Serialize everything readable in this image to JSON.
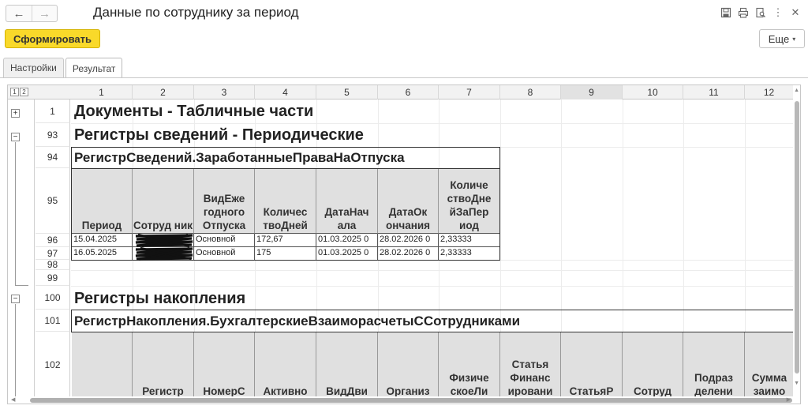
{
  "window": {
    "title": "Данные по сотруднику за период",
    "nav_back": "←",
    "nav_forward": "→"
  },
  "toolbar": {
    "form_button": "Сформировать",
    "more_button": "Еще",
    "more_caret": "▾"
  },
  "tabs": [
    {
      "label": "Настройки",
      "active": false
    },
    {
      "label": "Результат",
      "active": true
    }
  ],
  "sheet": {
    "level_buttons": [
      "1",
      "2"
    ],
    "columns": [
      "1",
      "2",
      "3",
      "4",
      "5",
      "6",
      "7",
      "8",
      "9",
      "10",
      "11",
      "12"
    ],
    "selected_column": "9",
    "row_numbers": [
      "1",
      "93",
      "94",
      "95",
      "96",
      "97",
      "98",
      "99",
      "100",
      "101",
      "102"
    ],
    "sections": {
      "documents": "Документы - Табличные части",
      "periodic_registers": "Регистры сведений - Периодические",
      "accumulation_registers": "Регистры накопления"
    },
    "register1": {
      "title": "РегистрСведений.ЗаработанныеПраваНаОтпуска",
      "headers": [
        "Период",
        "Сотруд ник",
        "ВидЕже годного Отпуска",
        "Количес твоДней",
        "ДатаНач ала",
        "ДатаОк ончания",
        "Количе ствоДне йЗаПер иод"
      ],
      "rows": [
        [
          "15.04.2025",
          "",
          "Основной",
          "172,67",
          "01.03.2025 0",
          "28.02.2026 0",
          "2,33333"
        ],
        [
          "16.05.2025",
          "",
          "Основной",
          "175",
          "01.03.2025 0",
          "28.02.2026 0",
          "2,33333"
        ]
      ]
    },
    "register2": {
      "title": "РегистрНакопления.БухгалтерскиеВзаиморасчетыССотрудниками",
      "headers": [
        "",
        "Регистр",
        "НомерС",
        "Активно",
        "ВидДви",
        "Организ",
        "Физиче скоеЛи",
        "Статья Финанс ировани",
        "СтатьяР",
        "Сотруд",
        "Подраз делени",
        "Сумма заимо"
      ]
    }
  }
}
